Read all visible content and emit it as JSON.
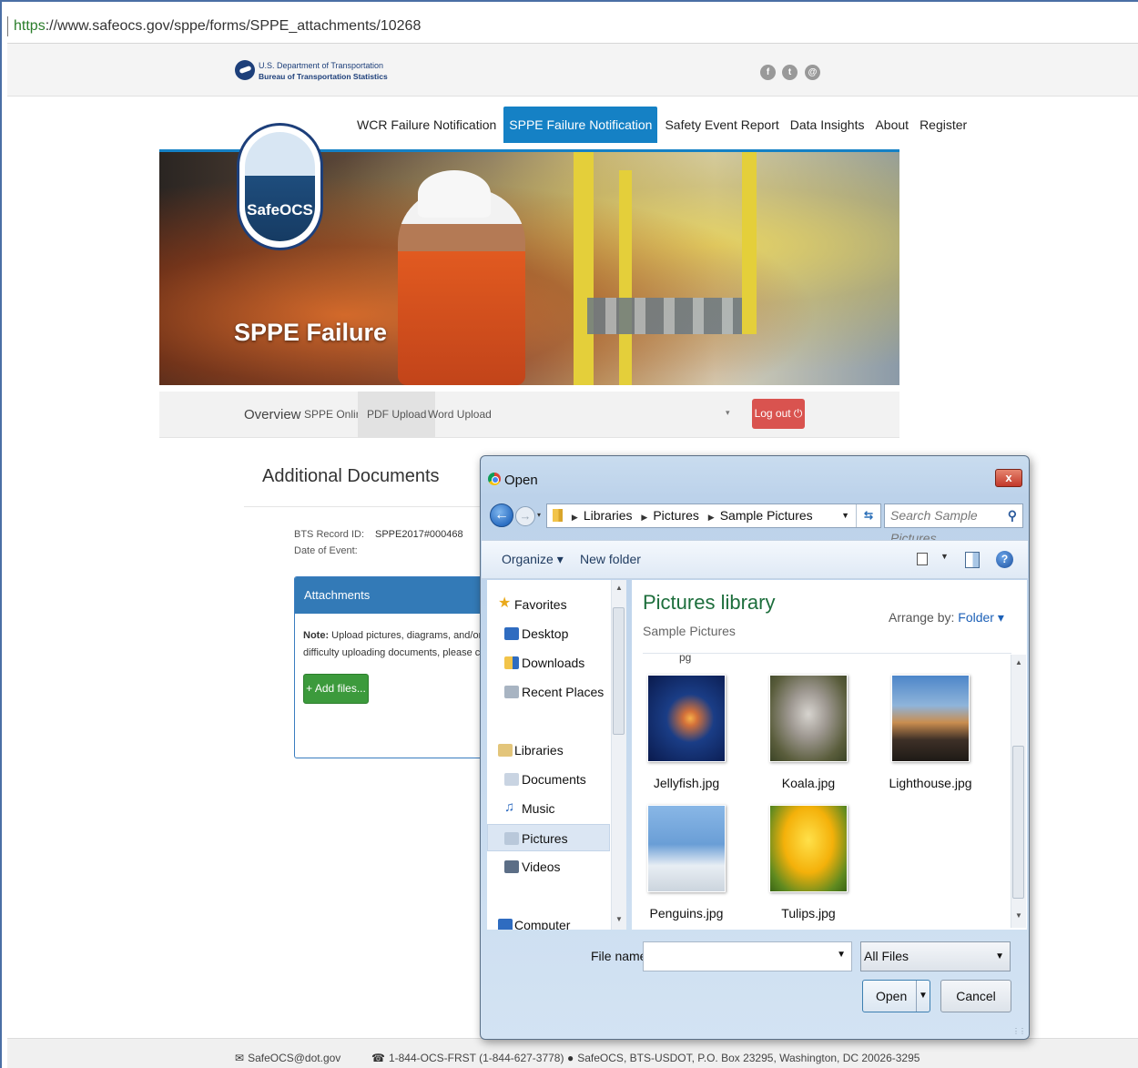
{
  "browser": {
    "url": "https://www.safeocs.gov/sppe/forms/SPPE_attachments/10268",
    "url_scheme": "https",
    "url_rest": "://www.safeocs.gov/sppe/forms/SPPE_attachments/10268"
  },
  "header": {
    "org_line1": "U.S. Department of Transportation",
    "org_line2": "Bureau of Transportation Statistics",
    "social_icons": [
      "facebook-icon",
      "twitter-icon",
      "email-icon"
    ]
  },
  "nav": {
    "items": [
      "WCR Failure Notification",
      "SPPE Failure Notification",
      "Safety Event Report",
      "Data Insights",
      "About",
      "Register"
    ],
    "active": "SPPE Failure Notification"
  },
  "hero": {
    "badge_text": "SafeOCS",
    "title": "SPPE Failure"
  },
  "subnav": {
    "items": [
      "Overview",
      "SPPE Online",
      "PDF Upload",
      "Word Upload"
    ],
    "active": "PDF Upload",
    "logout": "Log out ⏻"
  },
  "content": {
    "heading": "Additional Documents",
    "record_id_label": "BTS Record ID:",
    "record_id_value": "SPPE2017#000468",
    "event_date_label": "Date of Event:",
    "attachments_title": "Attachments",
    "note_bold": "Note:",
    "note_line1": "Upload pictures, diagrams, and/or other su",
    "note_line2": "difficulty uploading documents, please contact BT",
    "add_files": "+ Add files..."
  },
  "dialog": {
    "title": "Open",
    "close": "x",
    "breadcrumb": [
      "Libraries",
      "Pictures",
      "Sample Pictures"
    ],
    "search_placeholder": "Search Sample Pictures",
    "toolbar": {
      "organize": "Organize ▾",
      "new_folder": "New folder"
    },
    "tree": {
      "favorites": "Favorites",
      "desktop": "Desktop",
      "downloads": "Downloads",
      "recent": "Recent Places",
      "libraries": "Libraries",
      "documents": "Documents",
      "music": "Music",
      "pictures": "Pictures",
      "videos": "Videos",
      "computer": "Computer"
    },
    "library_title": "Pictures library",
    "library_sub": "Sample Pictures",
    "arrange_label": "Arrange by:",
    "arrange_value": "Folder ▾",
    "cut_text": "pg",
    "files": [
      "Jellyfish.jpg",
      "Koala.jpg",
      "Lighthouse.jpg",
      "Penguins.jpg",
      "Tulips.jpg"
    ],
    "filename_label": "File name:",
    "filename_value": "",
    "filetype": "All Files",
    "open_button": "Open",
    "cancel_button": "Cancel"
  },
  "footer": {
    "email": "SafeOCS@dot.gov",
    "phone": "1-844-OCS-FRST (1-844-627-3778)",
    "address": "SafeOCS, BTS-USDOT, P.O. Box 23295, Washington, DC 20026-3295"
  },
  "colors": {
    "accent": "#1581c5",
    "logout": "#d9534f",
    "add_files": "#3c9a3c",
    "panel_header": "#337ab7",
    "library_title": "#1d6e3c"
  }
}
